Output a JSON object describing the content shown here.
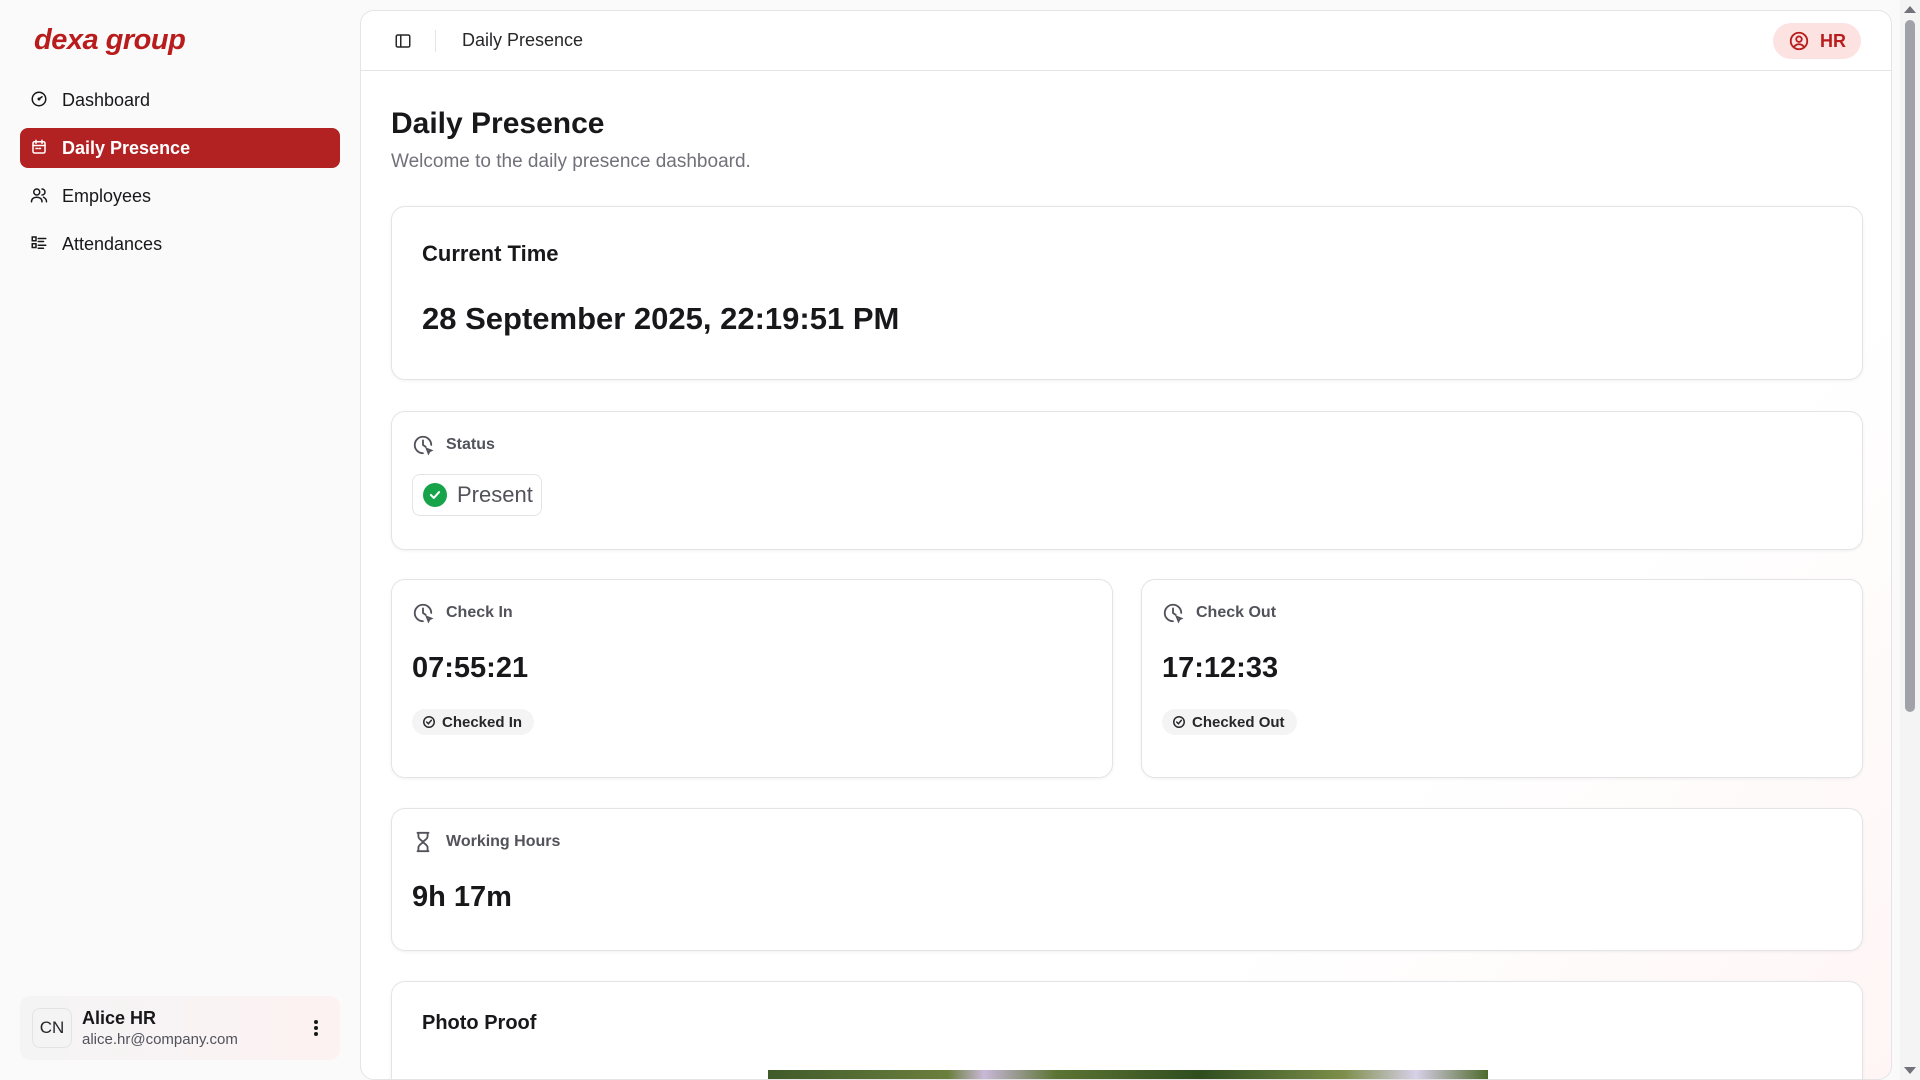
{
  "brand": {
    "logo_text": "dexa group",
    "color": "#b91c1c"
  },
  "sidebar": {
    "items": [
      {
        "label": "Dashboard",
        "icon": "gauge-icon",
        "active": false
      },
      {
        "label": "Daily Presence",
        "icon": "calendar-icon",
        "active": true
      },
      {
        "label": "Employees",
        "icon": "users-icon",
        "active": false
      },
      {
        "label": "Attendances",
        "icon": "list-checks-icon",
        "active": false
      }
    ],
    "user": {
      "initials": "CN",
      "name": "Alice HR",
      "email": "alice.hr@company.com"
    }
  },
  "topbar": {
    "breadcrumb": "Daily Presence",
    "role_badge": "HR"
  },
  "page": {
    "title": "Daily Presence",
    "subtitle": "Welcome to the daily presence dashboard."
  },
  "current_time": {
    "label": "Current Time",
    "value": "28 September 2025, 22:19:51 PM"
  },
  "status": {
    "label": "Status",
    "value": "Present",
    "color": "#16a34a"
  },
  "check_in": {
    "label": "Check In",
    "time": "07:55:21",
    "tag": "Checked In"
  },
  "check_out": {
    "label": "Check Out",
    "time": "17:12:33",
    "tag": "Checked Out"
  },
  "working_hours": {
    "label": "Working Hours",
    "value": "9h 17m"
  },
  "photo_proof": {
    "label": "Photo Proof"
  }
}
